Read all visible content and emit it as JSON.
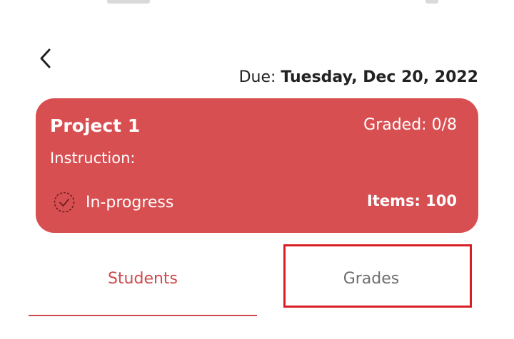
{
  "header": {
    "back_icon": "chevron-left-icon",
    "due_label": "Due:",
    "due_value": "Tuesday, Dec 20, 2022"
  },
  "card": {
    "title": "Project 1",
    "graded_label": "Graded:",
    "graded_value": "0/8",
    "instruction_label": "Instruction:",
    "status_icon": "check-circle-dashed-icon",
    "status": "In-progress",
    "items_label": "Items:",
    "items_value": "100",
    "background_color": "#d84f52"
  },
  "tabs": [
    {
      "label": "Students",
      "active": true
    },
    {
      "label": "Grades",
      "active": false,
      "highlighted": true
    }
  ],
  "colors": {
    "accent": "#cc4a4e",
    "inactive_tab_text": "#6e6e6e",
    "highlight_box": "#d81f26"
  }
}
